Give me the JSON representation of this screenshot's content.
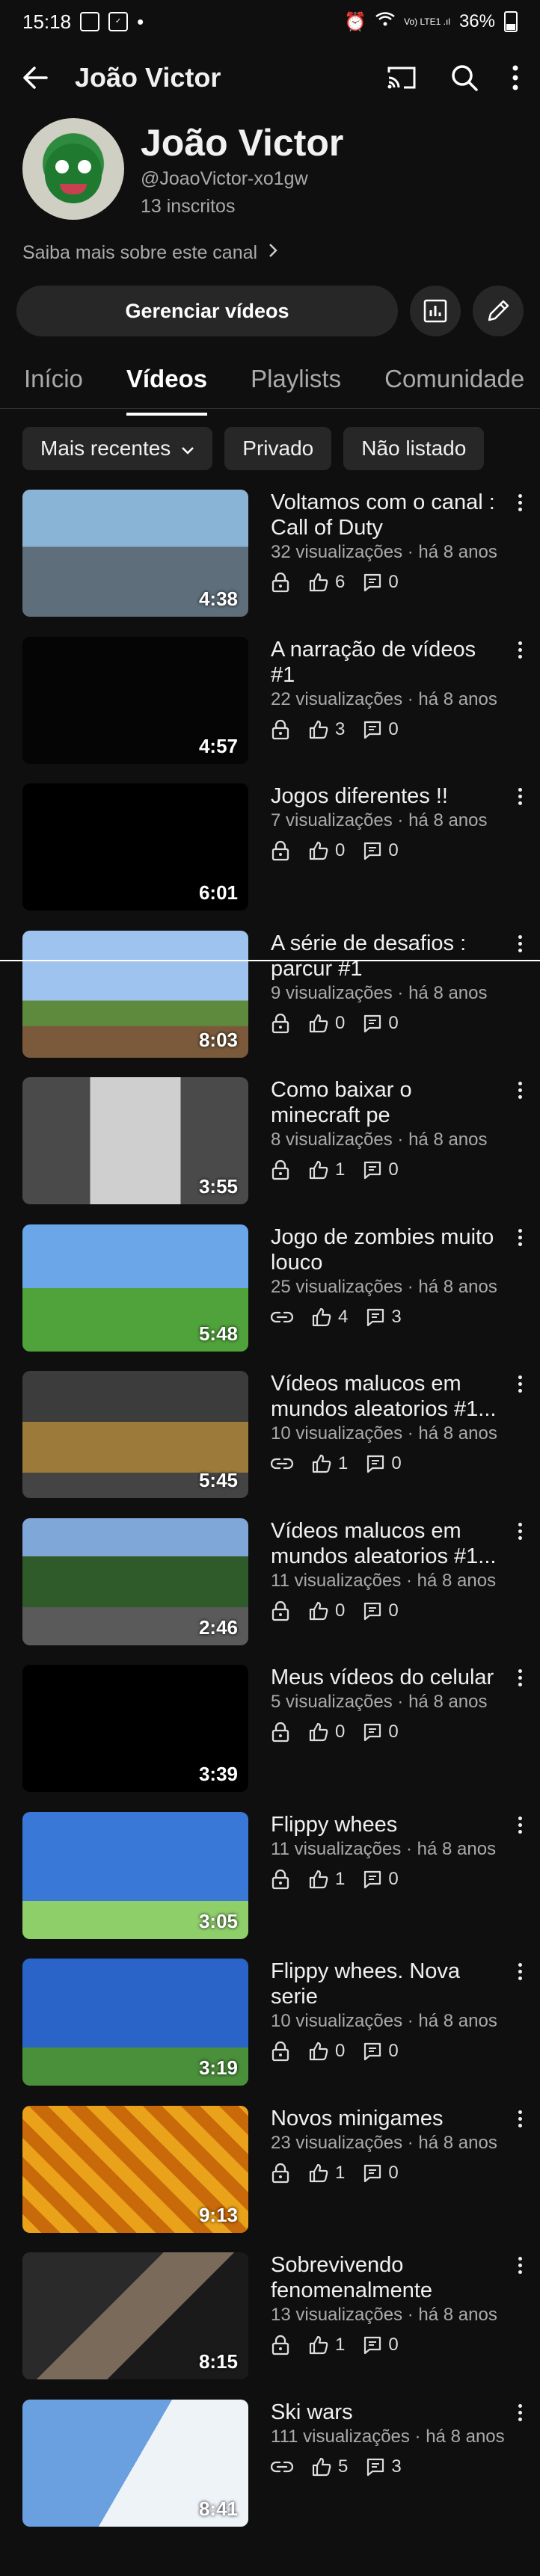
{
  "status_bar": {
    "time": "15:18",
    "battery": "36%",
    "network": "Vo) LTE1 .ıl"
  },
  "header": {
    "title": "João Victor"
  },
  "channel": {
    "name": "João Victor",
    "handle": "@JoaoVictor-xo1gw",
    "subscribers": "13 inscritos",
    "more_link": "Saiba mais sobre este canal"
  },
  "actions": {
    "manage_label": "Gerenciar vídeos"
  },
  "tabs": [
    "Início",
    "Vídeos",
    "Playlists",
    "Comunidade"
  ],
  "filters": {
    "sort": "Mais recentes",
    "private": "Privado",
    "unlisted": "Não listado"
  },
  "videos": [
    {
      "title": "Voltamos com o canal : Call of Duty",
      "meta": "32 visualizações · há 8 anos",
      "duration": "4:38",
      "visibility": "private",
      "likes": "6",
      "comments": "0",
      "thumb": "fps"
    },
    {
      "title": "A narração de vídeos #1",
      "meta": "22 visualizações · há 8 anos",
      "duration": "4:57",
      "visibility": "private",
      "likes": "3",
      "comments": "0",
      "thumb": "dark"
    },
    {
      "title": "Jogos diferentes !!",
      "meta": "7 visualizações · há 8 anos",
      "duration": "6:01",
      "visibility": "private",
      "likes": "0",
      "comments": "0",
      "thumb": "game"
    },
    {
      "title": "A série de desafios : parcur #1",
      "meta": "9 visualizações · há 8 anos",
      "duration": "8:03",
      "visibility": "private",
      "likes": "0",
      "comments": "0",
      "thumb": "mc-sky"
    },
    {
      "title": "Como baixar o minecraft pe",
      "meta": "8 visualizações · há 8 anos",
      "duration": "3:55",
      "visibility": "private",
      "likes": "1",
      "comments": "0",
      "thumb": "menu"
    },
    {
      "title": "Jogo de zombies muito louco",
      "meta": "25 visualizações · há 8 anos",
      "duration": "5:48",
      "visibility": "unlisted",
      "likes": "4",
      "comments": "3",
      "thumb": "zomb"
    },
    {
      "title": "Vídeos malucos em mundos aleatorios #1...",
      "meta": "10 visualizações · há 8 anos",
      "duration": "5:45",
      "visibility": "unlisted",
      "likes": "1",
      "comments": "0",
      "thumb": "mc-inside"
    },
    {
      "title": "Vídeos malucos em mundos aleatorios #1...",
      "meta": "11 visualizações · há 8 anos",
      "duration": "2:46",
      "visibility": "private",
      "likes": "0",
      "comments": "0",
      "thumb": "mc-forest"
    },
    {
      "title": "Meus vídeos do celular",
      "meta": "5 visualizações · há 8 anos",
      "duration": "3:39",
      "visibility": "private",
      "likes": "0",
      "comments": "0",
      "thumb": "black"
    },
    {
      "title": "Flippy whees",
      "meta": "11 visualizações · há 8 anos",
      "duration": "3:05",
      "visibility": "private",
      "likes": "1",
      "comments": "0",
      "thumb": "bike"
    },
    {
      "title": "Flippy whees. Nova serie",
      "meta": "10 visualizações · há 8 anos",
      "duration": "3:19",
      "visibility": "private",
      "likes": "0",
      "comments": "0",
      "thumb": "bike2"
    },
    {
      "title": "Novos minigames",
      "meta": "23 visualizações · há 8 anos",
      "duration": "9:13",
      "visibility": "private",
      "likes": "1",
      "comments": "0",
      "thumb": "lava"
    },
    {
      "title": "Sobrevivendo fenomenalmente",
      "meta": "13 visualizações · há 8 anos",
      "duration": "8:15",
      "visibility": "private",
      "likes": "1",
      "comments": "0",
      "thumb": "cave"
    },
    {
      "title": "Ski wars",
      "meta": "111 visualizações · há 8 anos",
      "duration": "8:41",
      "visibility": "unlisted",
      "likes": "5",
      "comments": "3",
      "thumb": "ski"
    }
  ]
}
